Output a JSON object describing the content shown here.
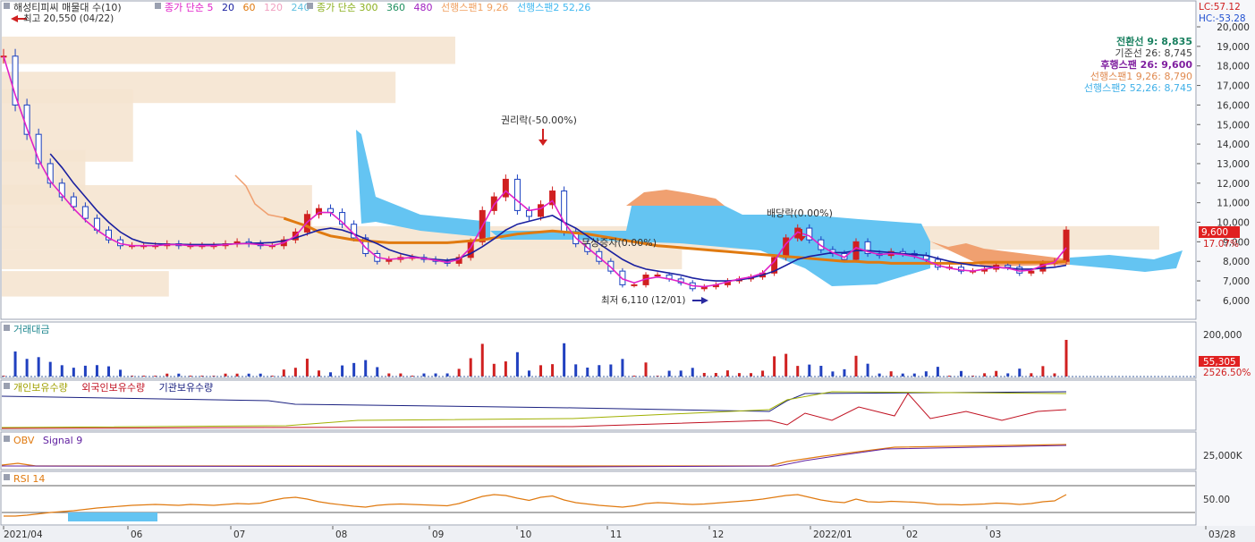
{
  "header": {
    "title": "해성티피씨 매물대 수(10)",
    "legend_items": [
      {
        "text": "종가 단순 5",
        "color": "#e020c8"
      },
      {
        "text": "20",
        "color": "#1a20a0"
      },
      {
        "text": "60",
        "color": "#e07a10"
      },
      {
        "text": "120",
        "color": "#f0a0c0"
      },
      {
        "text": "240",
        "color": "#60c0e0"
      },
      {
        "text": "종가 단순 300",
        "color": "#8cb020"
      },
      {
        "text": "360",
        "color": "#209060"
      },
      {
        "text": "480",
        "color": "#a020c0"
      },
      {
        "text": "선행스팬1 9,26",
        "color": "#f0a060"
      },
      {
        "text": "선행스팬2 52,26",
        "color": "#40b8f0"
      }
    ],
    "lc": "LC:57.12",
    "hc": "HC:-53.28"
  },
  "annotations": {
    "high": "최고 20,550 (04/22)",
    "low": "최저 6,110 (12/01)",
    "rights": "권리락(-50.00%)",
    "paid_increase": "무상증자(0.00%)",
    "dividend": "배당락(0.00%)"
  },
  "ichimoku_box": [
    {
      "label": "전환선 9: 8,835",
      "color": "#1a8060"
    },
    {
      "label": "기준선 26: 8,745",
      "color": "#404040"
    },
    {
      "label": "후행스팬 26: 9,600",
      "color": "#8020a0"
    },
    {
      "label": "선행스팬1 9,26: 8,790",
      "color": "#e08a50"
    },
    {
      "label": "선행스팬2 52,26: 8,745",
      "color": "#40b0e8"
    }
  ],
  "price_badges": {
    "price": "9,600",
    "pct": "17.07%"
  },
  "panels": {
    "volume": {
      "label": "거래대금",
      "badge": "55,305",
      "badge2": "2526.50%"
    },
    "holdings": {
      "labels": [
        {
          "text": "개인보유수량",
          "color": "#a0a000"
        },
        {
          "text": "외국인보유수량",
          "color": "#c01020"
        },
        {
          "text": "기관보유수량",
          "color": "#1a2080"
        }
      ]
    },
    "obv": {
      "labels": [
        {
          "text": "OBV",
          "color": "#e07a10"
        },
        {
          "text": "Signal 9",
          "color": "#6020a0"
        }
      ]
    },
    "rsi": {
      "label": "RSI 14"
    }
  },
  "chart_data": {
    "type": "candlestick",
    "price_axis": {
      "ticks": [
        "20,000",
        "19,000",
        "18,000",
        "17,000",
        "16,000",
        "15,000",
        "14,000",
        "13,000",
        "12,000",
        "11,000",
        "10,000",
        "9,000",
        "8,000",
        "7,000",
        "6,000"
      ]
    },
    "volume_axis": {
      "ticks": [
        "200,000"
      ]
    },
    "obv_axis": {
      "ticks": [
        "25,000K"
      ]
    },
    "rsi_axis": {
      "ticks": [
        "50.00"
      ]
    },
    "x_axis": {
      "ticks": [
        "2021/04",
        "06",
        "07",
        "08",
        "09",
        "10",
        "11",
        "12",
        "2022/01",
        "02",
        "03",
        "03/28"
      ]
    },
    "close_series": [
      18500,
      16000,
      14500,
      13000,
      12000,
      11300,
      10800,
      10200,
      9600,
      9100,
      8800,
      8800,
      8800,
      8800,
      8900,
      8800,
      8800,
      8800,
      8800,
      8900,
      9000,
      8900,
      8800,
      8800,
      9100,
      9500,
      10400,
      10700,
      10500,
      9900,
      9200,
      8400,
      8000,
      8100,
      8200,
      8200,
      8100,
      8000,
      7900,
      8200,
      9000,
      10600,
      11300,
      12200,
      10600,
      10300,
      10900,
      11600,
      9500,
      8900,
      8500,
      8000,
      7500,
      6800,
      6800,
      7300,
      7300,
      7100,
      6900,
      6600,
      6700,
      6800,
      7000,
      7100,
      7200,
      7400,
      8200,
      9200,
      9700,
      9100,
      8600,
      8400,
      8100,
      9000,
      8400,
      8300,
      8500,
      8400,
      8300,
      8100,
      7700,
      7700,
      7500,
      7500,
      7600,
      7800,
      7700,
      7400,
      7500,
      7900,
      8000,
      9600
    ],
    "sma5": [
      18500,
      16500,
      14800,
      13200,
      12100,
      11400,
      10700,
      10100,
      9600,
      9200,
      8900,
      8800,
      8800,
      8800,
      8850,
      8850,
      8800,
      8800,
      8800,
      8850,
      8900,
      8900,
      8850,
      8800,
      8950,
      9300,
      10000,
      10500,
      10500,
      10000,
      9400,
      8700,
      8200,
      8100,
      8150,
      8200,
      8150,
      8050,
      7950,
      8100,
      8700,
      9800,
      10900,
      11600,
      11100,
      10600,
      10700,
      11100,
      10000,
      9200,
      8700,
      8200,
      7700,
      7100,
      6900,
      7100,
      7200,
      7100,
      6950,
      6750,
      6700,
      6800,
      6950,
      7100,
      7200,
      7400,
      8000,
      8900,
      9500,
      9300,
      8800,
      8450,
      8200,
      8700,
      8500,
      8350,
      8400,
      8350,
      8250,
      8050,
      7800,
      7650,
      7550,
      7500,
      7600,
      7700,
      7650,
      7500,
      7550,
      7800,
      7950,
      8700
    ],
    "sma20": [
      null,
      null,
      null,
      null,
      13500,
      12800,
      12000,
      11300,
      10600,
      10000,
      9500,
      9150,
      8950,
      8900,
      8880,
      8870,
      8860,
      8860,
      8860,
      8870,
      8900,
      8920,
      8940,
      8960,
      9050,
      9200,
      9400,
      9600,
      9700,
      9600,
      9400,
      9150,
      8900,
      8600,
      8400,
      8250,
      8150,
      8100,
      8050,
      8150,
      8400,
      8750,
      9150,
      9600,
      9900,
      10050,
      10200,
      10350,
      10000,
      9700,
      9300,
      8900,
      8500,
      8100,
      7800,
      7600,
      7500,
      7400,
      7300,
      7150,
      7050,
      7000,
      7000,
      7050,
      7150,
      7300,
      7500,
      7800,
      8100,
      8250,
      8350,
      8450,
      8450,
      8550,
      8550,
      8500,
      8450,
      8400,
      8350,
      8300,
      8150,
      8000,
      7900,
      7800,
      7750,
      7700,
      7650,
      7600,
      7600,
      7650,
      7700,
      7800
    ],
    "sma60": [
      null,
      null,
      null,
      null,
      null,
      null,
      null,
      null,
      null,
      null,
      null,
      null,
      null,
      null,
      null,
      null,
      null,
      null,
      null,
      null,
      null,
      null,
      null,
      null,
      10200,
      10000,
      9800,
      9500,
      9300,
      9200,
      9100,
      9050,
      9000,
      8950,
      8950,
      8950,
      8950,
      8950,
      8950,
      9000,
      9050,
      9100,
      9200,
      9300,
      9400,
      9450,
      9500,
      9550,
      9500,
      9450,
      9400,
      9300,
      9200,
      9100,
      9000,
      8900,
      8800,
      8750,
      8700,
      8650,
      8600,
      8550,
      8500,
      8450,
      8400,
      8350,
      8300,
      8250,
      8200,
      8150,
      8100,
      8050,
      8000,
      8000,
      7950,
      7950,
      7900,
      7900,
      7900,
      7900,
      7900,
      7900,
      7900,
      7900,
      7950,
      7950,
      7950,
      7950,
      7950,
      7950,
      7950,
      8000
    ],
    "support_zones": [
      {
        "lo": 18100,
        "hi": 19500,
        "w": 0.38
      },
      {
        "lo": 16100,
        "hi": 17700,
        "w": 0.33
      },
      {
        "lo": 13100,
        "hi": 16800,
        "w": 0.11
      },
      {
        "lo": 10900,
        "hi": 13700,
        "w": 0.07
      },
      {
        "lo": 9700,
        "hi": 11900,
        "w": 0.26
      },
      {
        "lo": 8600,
        "hi": 9800,
        "w": 0.97
      },
      {
        "lo": 7600,
        "hi": 8600,
        "w": 0.57
      },
      {
        "lo": 6200,
        "hi": 7500,
        "w": 0.14
      }
    ],
    "rsi_values": [
      20,
      20,
      22,
      25,
      28,
      30,
      32,
      35,
      38,
      40,
      42,
      44,
      45,
      46,
      45,
      44,
      46,
      45,
      44,
      46,
      48,
      47,
      49,
      55,
      60,
      62,
      58,
      52,
      48,
      45,
      42,
      40,
      44,
      46,
      47,
      46,
      45,
      44,
      43,
      48,
      56,
      64,
      68,
      66,
      60,
      55,
      62,
      65,
      56,
      50,
      47,
      44,
      42,
      40,
      43,
      48,
      50,
      49,
      47,
      46,
      47,
      49,
      51,
      53,
      55,
      58,
      62,
      66,
      68,
      62,
      56,
      52,
      50,
      58,
      52,
      51,
      53,
      52,
      51,
      49,
      46,
      46,
      45,
      46,
      47,
      49,
      48,
      46,
      48,
      52,
      54,
      68
    ]
  }
}
